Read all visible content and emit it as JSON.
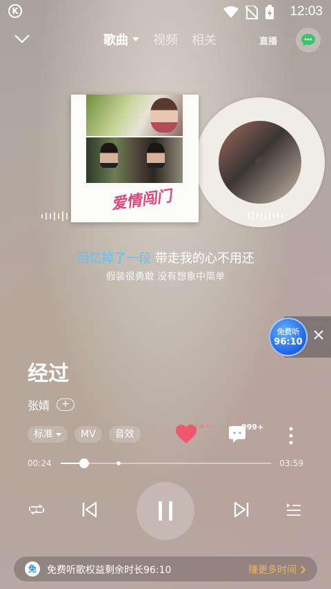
{
  "status": {
    "time": "12:03",
    "app_badge": "K"
  },
  "nav": {
    "tabs": [
      {
        "label": "歌曲",
        "active": true
      },
      {
        "label": "视频",
        "active": false
      },
      {
        "label": "相关",
        "active": false
      }
    ],
    "live_label": "直播"
  },
  "lyrics": {
    "current_highlight": "回忆掉了一段",
    "current_rest": " 带走我的心不用还",
    "next": "假装很勇敢 没有想象中简单"
  },
  "cover_art_text": "爱情闯门",
  "free_badge": {
    "line1": "免费听",
    "line2": "96:10"
  },
  "song": {
    "title": "经过",
    "artist": "张婧",
    "follow_label": "+"
  },
  "chips": [
    {
      "label": "标准",
      "dropdown": true
    },
    {
      "label": "MV",
      "dropdown": false
    },
    {
      "label": "音效",
      "dropdown": false
    }
  ],
  "actions": {
    "like_count": "1w+",
    "comment_count": "999+"
  },
  "progress": {
    "current": "00:24",
    "total": "03:59",
    "fraction": 0.11,
    "marker_fraction": 0.275
  },
  "bottom_bar": {
    "icon_label": "免",
    "text": "免费听歌权益剩余时长96:10",
    "cta": "赚更多时间"
  },
  "colors": {
    "lyric_highlight": "#5fc2f5",
    "heart": "#f0566e",
    "cta": "#f0b35c"
  }
}
